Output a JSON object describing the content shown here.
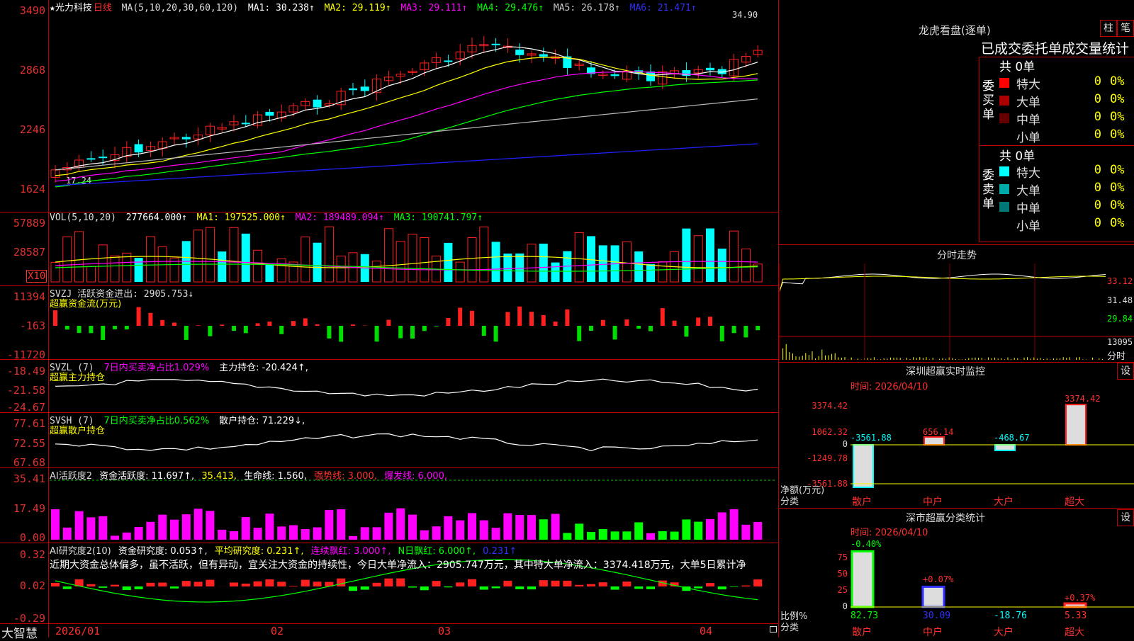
{
  "header": {
    "title": "★光力科技",
    "period": "日线",
    "ma_params": "MA(5,10,20,30,60,120)",
    "ma": [
      {
        "label": "MA1: 30.238↑",
        "color": "#ffffff"
      },
      {
        "label": "MA2: 29.119↑",
        "color": "#ffff00"
      },
      {
        "label": "MA3: 29.111↑",
        "color": "#ff00ff"
      },
      {
        "label": "MA4: 29.476↑",
        "color": "#00ff00"
      },
      {
        "label": "MA5: 26.178↑",
        "color": "#cccccc"
      },
      {
        "label": "MA6: 21.471↑",
        "color": "#3030ff"
      }
    ],
    "high_marker": "34.90",
    "low_marker": "17.24"
  },
  "price_axis": [
    "3490",
    "2868",
    "2246",
    "1624"
  ],
  "vol": {
    "label": "VOL(5,10,20)",
    "value": "277664.000↑",
    "ma": [
      {
        "label": "MA1: 197525.000↑",
        "color": "#ffff00"
      },
      {
        "label": "MA2: 189489.094↑",
        "color": "#ff00ff"
      },
      {
        "label": "MA3: 190741.797↑",
        "color": "#00ff00"
      }
    ],
    "axis": [
      "57889",
      "28587"
    ],
    "unit": "X10"
  },
  "svzj": {
    "label": "SVZJ  活跃资金进出: 2905.753↓",
    "sub": "超赢资金流(万元)",
    "axis": [
      "11394",
      "-163",
      "-11720"
    ]
  },
  "svzl": {
    "label": "SVZL (7)",
    "p1": "7日内买卖净占比1.029%",
    "p2": "主力持仓: -20.424↑,",
    "sub": "超赢主力持仓",
    "axis": [
      "-18.49",
      "-21.58",
      "-24.67"
    ]
  },
  "svsh": {
    "label": "SVSH (7)",
    "p1": "7日内买卖净占比0.562%",
    "p2": "散户持仓: 71.229↓,",
    "sub": "超赢散户持仓",
    "axis": [
      "77.61",
      "72.55",
      "67.68"
    ]
  },
  "ai1": {
    "label": "AI活跃度2",
    "p1": "资金活跃度: 11.697↑,",
    "p2": "35.413,",
    "p3": "生命线: 1.560,",
    "p4": "强势线: 3.000,",
    "p5": "爆发线: 6.000,",
    "axis": [
      "35.41",
      "17.49",
      "0.00"
    ]
  },
  "ai2": {
    "label": "AI研究度2(10)",
    "p1": "资金研究度: 0.053↑,",
    "p2": "平均研究度: 0.231↑,",
    "p3": "连续飘红: 3.000↑,",
    "p4": "N日飘红: 6.000↑,",
    "p5": "0.231↑",
    "note": "近期大资金总体偏多，虽不活跃，但有异动，宜关注大资金的持续性，今日大单净流入：2905.747万元，其中特大单净流入：3374.418万元，大单5日累计净",
    "axis": [
      "0.32",
      "0.02",
      "-0.29"
    ]
  },
  "dates": [
    "2026/01",
    "02",
    "03",
    "04"
  ],
  "brand": "大智慧",
  "right": {
    "title": "龙虎看盘(逐单)",
    "btn_bar": "柱",
    "btn_pen": "笔",
    "tabs": "已成交委托单成交量统计",
    "buy": {
      "side": "委买单",
      "total": "共 0单",
      "rows": [
        {
          "name": "特大",
          "count": "0",
          "pct": "0%",
          "color": "#ff0000"
        },
        {
          "name": "大单",
          "count": "0",
          "pct": "0%",
          "color": "#aa0000"
        },
        {
          "name": "中单",
          "count": "0",
          "pct": "0%",
          "color": "#660000"
        },
        {
          "name": "小单",
          "count": "0",
          "pct": "0%",
          "color": "#000000"
        }
      ]
    },
    "sell": {
      "side": "委卖单",
      "total": "共 0单",
      "rows": [
        {
          "name": "特大",
          "count": "0",
          "pct": "0%",
          "color": "#00ffff"
        },
        {
          "name": "大单",
          "count": "0",
          "pct": "0%",
          "color": "#00aaaa"
        },
        {
          "name": "中单",
          "count": "0",
          "pct": "0%",
          "color": "#007777"
        },
        {
          "name": "小单",
          "count": "0",
          "pct": "0%",
          "color": "#000000"
        }
      ]
    },
    "intraday": {
      "title": "分时走势",
      "axis": [
        "33.12",
        "31.48",
        "29.84",
        "13095"
      ],
      "unit": "分时"
    },
    "sz_monitor": {
      "title": "深圳超赢实时监控",
      "btn": "设",
      "time": "时间: 2026/04/10",
      "axis": [
        "3374.42",
        "1062.32",
        "0",
        "-1249.78",
        "-3561.88"
      ],
      "label1": "净额(万元)",
      "label2": "分类",
      "cats": [
        "散户",
        "中户",
        "大户",
        "超大"
      ],
      "values": [
        {
          "text": "-3561.88",
          "value": -3561.88
        },
        {
          "text": "656.14",
          "value": 656.14
        },
        {
          "text": "-468.67",
          "value": -468.67
        },
        {
          "text": "3374.42",
          "value": 3374.42
        }
      ]
    },
    "sz_category": {
      "title": "深市超赢分类统计",
      "btn": "设",
      "time": "时间: 2026/04/10",
      "axis": [
        "75",
        "50",
        "25",
        "0"
      ],
      "label1": "比例%",
      "label2": "分类",
      "cats": [
        "散户",
        "中户",
        "大户",
        "超大"
      ],
      "changes": [
        "-0.40%",
        "+0.07%",
        "",
        "+0.37%"
      ],
      "values": [
        {
          "text": "82.73",
          "value": 82.73
        },
        {
          "text": "30.09",
          "value": 30.09
        },
        {
          "text": "-18.76",
          "value": -18.76
        },
        {
          "text": "5.33",
          "value": 5.33
        }
      ]
    }
  }
}
